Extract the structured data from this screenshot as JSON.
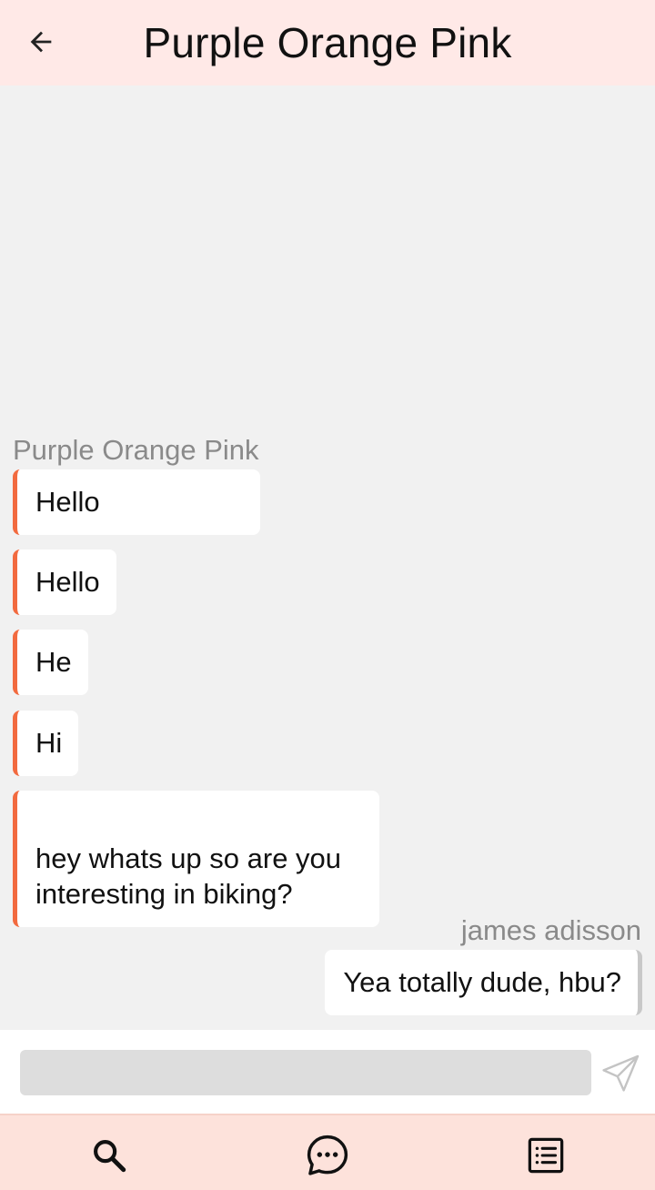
{
  "header": {
    "title": "Purple Orange Pink",
    "back_icon": "arrow-left-icon"
  },
  "conversation": {
    "contact_name": "Purple Orange Pink",
    "user_name": "james adisson",
    "incoming": [
      {
        "text": "Hello"
      },
      {
        "text": "Hello"
      },
      {
        "text": "He"
      },
      {
        "text": "Hi"
      },
      {
        "text": "hey whats up so are you\ninteresting in biking?"
      }
    ],
    "outgoing": [
      {
        "text": "Yea totally dude, hbu?"
      }
    ]
  },
  "composer": {
    "value": "",
    "placeholder": "",
    "send_icon": "send-icon"
  },
  "bottom_nav": {
    "items": [
      {
        "icon": "search-icon"
      },
      {
        "icon": "chat-bubble-icon"
      },
      {
        "icon": "list-icon"
      }
    ]
  },
  "colors": {
    "header_bg": "#ffe9e7",
    "chat_bg": "#f1f1f1",
    "incoming_accent": "#f26a3f",
    "outgoing_accent": "#c8c8c8",
    "nav_bg": "#fde2db",
    "input_bg": "#dddddd"
  }
}
